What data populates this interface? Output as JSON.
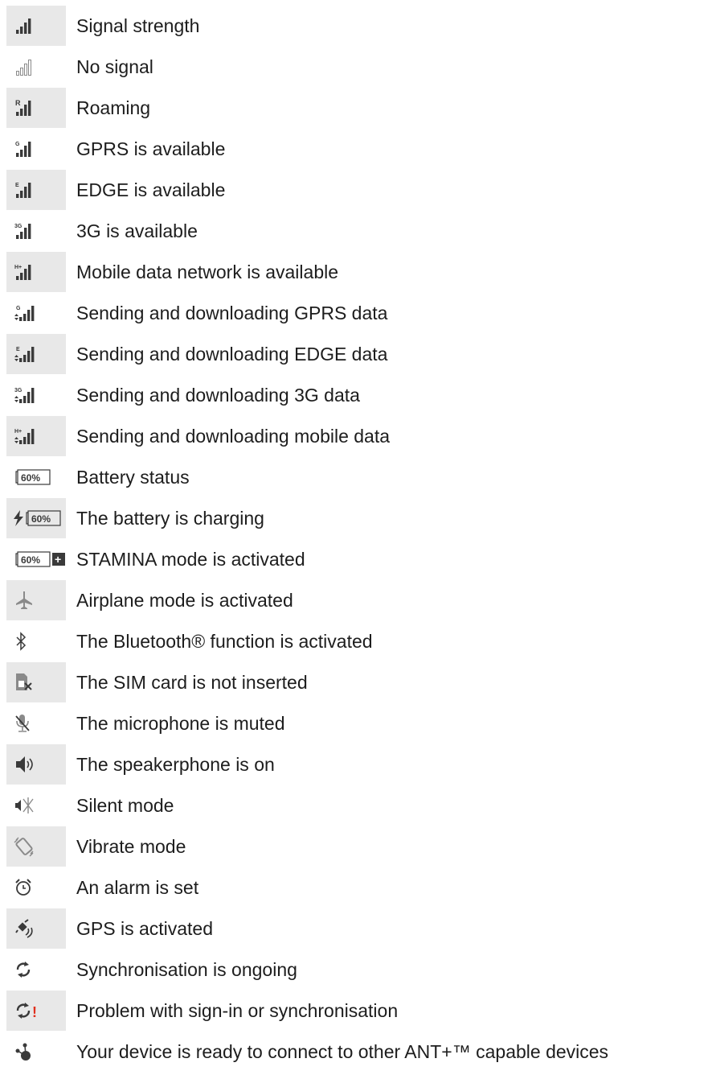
{
  "legend": {
    "rows": [
      {
        "icon": "signal-strength-icon",
        "label": "Signal strength",
        "shaded": true
      },
      {
        "icon": "no-signal-icon",
        "label": "No signal",
        "shaded": false
      },
      {
        "icon": "roaming-icon",
        "label": "Roaming",
        "shaded": true
      },
      {
        "icon": "gprs-icon",
        "label": "GPRS is available",
        "shaded": false
      },
      {
        "icon": "edge-icon",
        "label": "EDGE is available",
        "shaded": true
      },
      {
        "icon": "3g-icon",
        "label": "3G is available",
        "shaded": false
      },
      {
        "icon": "mobile-data-icon",
        "label": "Mobile data network is available",
        "shaded": true
      },
      {
        "icon": "gprs-transfer-icon",
        "label": "Sending and downloading GPRS data",
        "shaded": false
      },
      {
        "icon": "edge-transfer-icon",
        "label": "Sending and downloading EDGE data",
        "shaded": true
      },
      {
        "icon": "3g-transfer-icon",
        "label": "Sending and downloading 3G data",
        "shaded": false
      },
      {
        "icon": "mobile-data-transfer-icon",
        "label": "Sending and downloading mobile data",
        "shaded": true
      },
      {
        "icon": "battery-status-icon",
        "label": "Battery status",
        "shaded": false
      },
      {
        "icon": "battery-charging-icon",
        "label": "The battery is charging",
        "shaded": true
      },
      {
        "icon": "stamina-mode-icon",
        "label": "STAMINA mode is activated",
        "shaded": false
      },
      {
        "icon": "airplane-mode-icon",
        "label": "Airplane mode is activated",
        "shaded": true
      },
      {
        "icon": "bluetooth-icon",
        "label": "The Bluetooth® function is activated",
        "shaded": false
      },
      {
        "icon": "sim-card-missing-icon",
        "label": "The SIM card is not inserted",
        "shaded": true
      },
      {
        "icon": "microphone-muted-icon",
        "label": "The microphone is muted",
        "shaded": false
      },
      {
        "icon": "speakerphone-icon",
        "label": "The speakerphone is on",
        "shaded": true
      },
      {
        "icon": "silent-mode-icon",
        "label": "Silent mode",
        "shaded": false
      },
      {
        "icon": "vibrate-mode-icon",
        "label": "Vibrate mode",
        "shaded": true
      },
      {
        "icon": "alarm-icon",
        "label": "An alarm is set",
        "shaded": false
      },
      {
        "icon": "gps-icon",
        "label": "GPS is activated",
        "shaded": true
      },
      {
        "icon": "sync-icon",
        "label": "Synchronisation is ongoing",
        "shaded": false
      },
      {
        "icon": "sync-problem-icon",
        "label": "Problem with sign-in or synchronisation",
        "shaded": true
      },
      {
        "icon": "ant-plus-icon",
        "label": "Your device is ready to connect  to other ANT+™ capable devices",
        "shaded": false
      }
    ],
    "icon_text": {
      "roaming": "R",
      "gprs": "G",
      "edge": "E",
      "three_g": "3G",
      "mobile_data": "H+",
      "battery_level": "60%",
      "stamina_plus": "+",
      "problem_mark": "!"
    },
    "colors": {
      "shade": "#e8e8e8",
      "icon": "#3a3a3a",
      "icon_light": "#8a8a8a",
      "error": "#e0301e"
    }
  }
}
